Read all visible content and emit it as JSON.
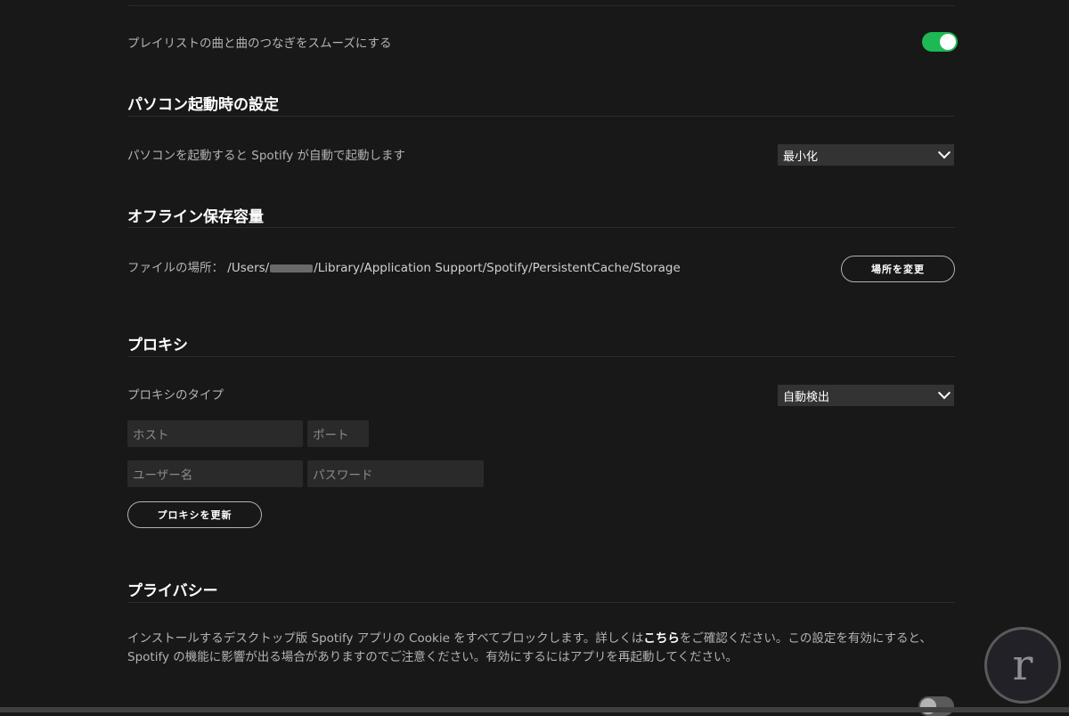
{
  "playback": {
    "crossfade_label": "プレイリストの曲と曲のつなぎをスムーズにする",
    "crossfade_on": true
  },
  "startup": {
    "title": "パソコン起動時の設定",
    "description": "パソコンを起動すると Spotify が自動で起動します",
    "select_value": "最小化"
  },
  "offline": {
    "title": "オフライン保存容量",
    "location_label": "ファイルの場所：",
    "path_prefix": "/Users/",
    "path_suffix": "/Library/Application Support/Spotify/PersistentCache/Storage",
    "change_button": "場所を変更"
  },
  "proxy": {
    "title": "プロキシ",
    "type_label": "プロキシのタイプ",
    "type_value": "自動検出",
    "host_placeholder": "ホスト",
    "port_placeholder": "ポート",
    "username_placeholder": "ユーザー名",
    "password_placeholder": "パスワード",
    "update_button": "プロキシを更新"
  },
  "privacy": {
    "title": "プライバシー",
    "text_before_link": "インストールするデスクトップ版 Spotify アプリの Cookie をすべてブロックします。詳しくは",
    "link_text": "こちら",
    "text_after_link": "をご確認ください。この設定を有効にすると、Spotify の機能に影響が出る場合がありますのでご注意ください。有効にするにはアプリを再起動してください。",
    "cookie_toggle_on": false
  },
  "watermark": {
    "letter": "r"
  },
  "colors": {
    "accent": "#1db954",
    "background": "#181818",
    "text": "#b3b3b3"
  }
}
